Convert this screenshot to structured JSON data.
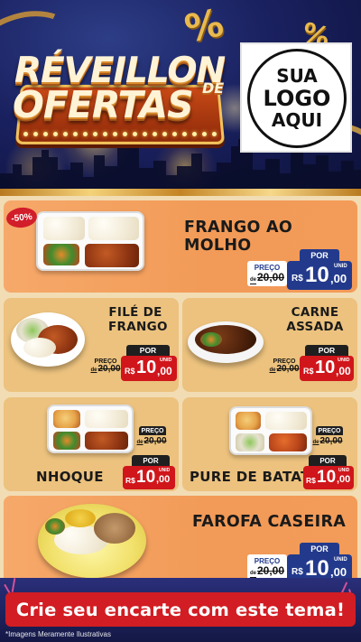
{
  "header": {
    "title_line1": "RÉVEILLON",
    "title_de": "DE",
    "title_line2": "OFERTAS",
    "percent_symbol": "%",
    "logo_line1": "SUA",
    "logo_line2": "LOGO",
    "logo_line3": "AQUI"
  },
  "colors": {
    "accent_red": "#d0161b",
    "accent_blue": "#233a8c",
    "card_orange": "#f29a57",
    "card_tan": "#ecc27e"
  },
  "currency": "R$",
  "labels": {
    "preco": "PREÇO",
    "por": "POR",
    "unid": "UNID",
    "de_prefix": "de"
  },
  "items": [
    {
      "name": "FRANGO AO MOLHO",
      "badge": "-50%",
      "old_price": "20,00",
      "new_price_int": "10",
      "new_price_cents": ",00"
    },
    {
      "name_line1": "FILÉ DE",
      "name_line2": "FRANGO",
      "old_price": "20,00",
      "new_price_int": "10",
      "new_price_cents": ",00"
    },
    {
      "name_line1": "CARNE",
      "name_line2": "ASSADA",
      "old_price": "20,00",
      "new_price_int": "10",
      "new_price_cents": ",00"
    },
    {
      "name": "NHOQUE",
      "old_price": "20,00",
      "new_price_int": "10",
      "new_price_cents": ",00"
    },
    {
      "name": "PURE DE BATATA",
      "old_price": "20,00",
      "new_price_int": "10",
      "new_price_cents": ",00"
    },
    {
      "name": "FAROFA CASEIRA",
      "old_price": "20,00",
      "new_price_int": "10",
      "new_price_cents": ",00"
    }
  ],
  "cta": "Crie seu encarte com este tema!",
  "disclaimer": "*Imagens Meramente Ilustrativas"
}
